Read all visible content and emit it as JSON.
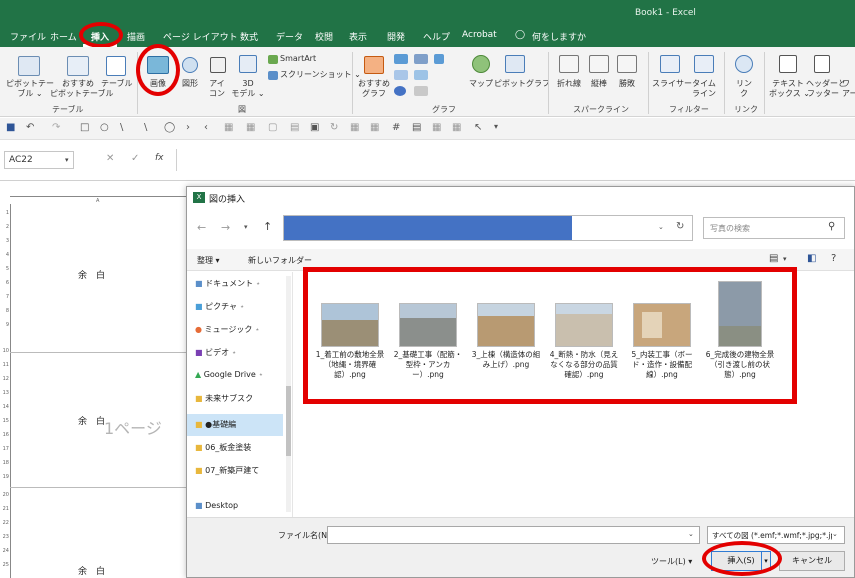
{
  "app": {
    "title": "Book1 - Excel"
  },
  "tabs": [
    "ファイル",
    "ホーム",
    "挿入",
    "描画",
    "ページ レイアウト",
    "数式",
    "データ",
    "校閲",
    "表示",
    "開発",
    "ヘルプ",
    "Acrobat",
    "何をしますか"
  ],
  "ribbon": {
    "pivot_table": "ピボットテー\nブル ⌄",
    "recommended_pivot": "おすすめ\nピボットテーブル",
    "table": "テーブル",
    "group_table": "テーブル",
    "image": "画像",
    "shapes": "図形",
    "icons": "アイ\nコン",
    "model3d": "3D\nモデル ⌄",
    "smartart": "SmartArt",
    "screenshot": "スクリーンショット ⌄",
    "group_illust": "図",
    "recommended_chart": "おすすめ\nグラフ",
    "map": "マップ",
    "pivot_chart": "ピボットグラフ",
    "group_chart": "グラフ",
    "spark_line": "折れ線",
    "spark_column": "縦棒",
    "spark_winloss": "勝敗",
    "group_sparkline": "スパークライン",
    "slicer": "スライサー",
    "timeline": "タイム\nライン",
    "group_filter": "フィルター",
    "link": "リン\nク",
    "group_link": "リンク",
    "textbox": "テキスト\nボックス ⌄",
    "header_footer": "ヘッダーと\nフッター",
    "wordart": "ワ\nアー"
  },
  "namebox": "AC22",
  "formula_buttons": [
    "✕",
    "✓",
    "fx"
  ],
  "sheet": {
    "column_header": "A",
    "margin_label": "余　白",
    "watermark": "1ページ",
    "row_numbers": [
      "1",
      "2",
      "3",
      "4",
      "5",
      "6",
      "7",
      "8",
      "9",
      "10",
      "11",
      "12",
      "13",
      "14",
      "15",
      "16",
      "17",
      "18",
      "19",
      "20",
      "21",
      "22",
      "23",
      "24",
      "25"
    ]
  },
  "dialog": {
    "title": "図の挿入",
    "search_placeholder": "写真の検索",
    "organize": "整理 ▾",
    "new_folder": "新しいフォルダー",
    "nav_items": [
      "ドキュメント",
      "ピクチャ",
      "ミュージック",
      "ビデオ",
      "Google Drive",
      "未来サブスク",
      "●基礎編",
      "06_板金塗装",
      "07_新築戸建て",
      "Desktop"
    ],
    "files": [
      {
        "name": "1_着工前の敷地全景（地縄・境界確認）.png",
        "thumb": "#9b8f76"
      },
      {
        "name": "2_基礎工事（配筋・型枠・アンカー）.png",
        "thumb": "#8b8f8c"
      },
      {
        "name": "3_上棟（構造体の組み上げ）.png",
        "thumb": "#b89a72"
      },
      {
        "name": "4_断熱・防水（見えなくなる部分の品質確認）.png",
        "thumb": "#c9bfae"
      },
      {
        "name": "5_内装工事（ボード・造作・設備配線）.png",
        "thumb": "#c8a67c"
      },
      {
        "name": "6_完成後の建物全景（引き渡し前の状態）.png",
        "thumb": "#8c9aa8"
      }
    ],
    "filename_label": "ファイル名(N):",
    "filetype": "すべての図 (*.emf;*.wmf;*.jpg;*.jp",
    "tools": "ツール(L)  ▾",
    "insert": "挿入(S)",
    "cancel": "キャンセル"
  },
  "colors": {
    "excel_green": "#217346",
    "highlight_red": "#e30000",
    "address_redaction": "#4472c4"
  }
}
